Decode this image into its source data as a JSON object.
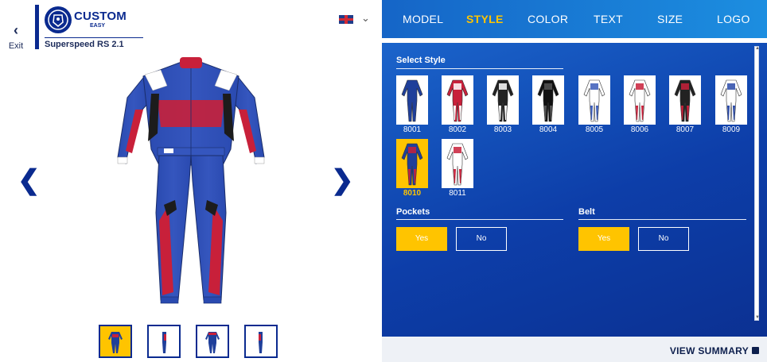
{
  "header": {
    "exit_label": "Exit",
    "logo_line1": "CUSTOM",
    "logo_line2": "EASY",
    "model_name": "Superspeed RS 2.1",
    "language_flag": "uk-flag-icon"
  },
  "nav": {
    "tabs": [
      {
        "label": "MODEL",
        "active": false
      },
      {
        "label": "STYLE",
        "active": true
      },
      {
        "label": "COLOR",
        "active": false
      },
      {
        "label": "TEXT",
        "active": false
      },
      {
        "label": "SIZE",
        "active": false
      },
      {
        "label": "LOGO",
        "active": false
      }
    ]
  },
  "select_style": {
    "title": "Select Style",
    "selected": "8010",
    "items": [
      {
        "code": "8001",
        "primary": "#1f3f9a",
        "accent": "#1f3f9a"
      },
      {
        "code": "8002",
        "primary": "#c8203a",
        "accent": "#ffffff"
      },
      {
        "code": "8003",
        "primary": "#222222",
        "accent": "#ffffff"
      },
      {
        "code": "8004",
        "primary": "#111111",
        "accent": "#555555"
      },
      {
        "code": "8005",
        "primary": "#ffffff",
        "accent": "#3a5bb8"
      },
      {
        "code": "8006",
        "primary": "#ffffff",
        "accent": "#c8203a"
      },
      {
        "code": "8007",
        "primary": "#222222",
        "accent": "#c8203a"
      },
      {
        "code": "8009",
        "primary": "#ffffff",
        "accent": "#2a4aa8"
      },
      {
        "code": "8010",
        "primary": "#1f3f9a",
        "accent": "#c8203a"
      },
      {
        "code": "8011",
        "primary": "#ffffff",
        "accent": "#c8203a"
      }
    ]
  },
  "pockets": {
    "title": "Pockets",
    "yes": "Yes",
    "no": "No",
    "value": "Yes"
  },
  "belt": {
    "title": "Belt",
    "yes": "Yes",
    "no": "No",
    "value": "Yes"
  },
  "footer": {
    "view_summary": "VIEW SUMMARY",
    "icon": "save-icon"
  },
  "colors": {
    "accent": "#ffc400",
    "brand": "#0a2a8f",
    "panel": "#1560c8",
    "suit_blue": "#1f3f9a",
    "suit_red": "#c8203a"
  }
}
